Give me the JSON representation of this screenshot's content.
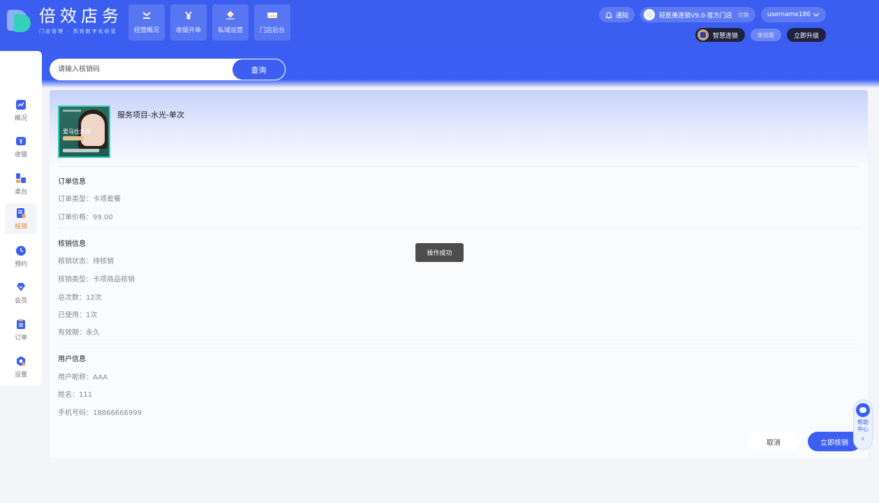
{
  "app": {
    "title": "倍效店务",
    "subtitle": "门店管理 · 高效数字化经营"
  },
  "top_nav": [
    {
      "label": "经营概况",
      "icon": "trend-icon"
    },
    {
      "label": "收银开单",
      "icon": "yen-icon"
    },
    {
      "label": "私域运营",
      "icon": "diamond-icon"
    },
    {
      "label": "门店后台",
      "icon": "store-icon"
    }
  ],
  "header": {
    "notify_label": "通知",
    "store_name": "轻医美连锁V9.0-官方门店",
    "switch_label": "切换",
    "username": "username186",
    "plan_label": "智慧连锁",
    "trial_label": "体验版",
    "upgrade_label": "立即升级"
  },
  "sidebar": {
    "items": [
      {
        "label": "概况",
        "icon": "chart-icon",
        "active": false
      },
      {
        "label": "收银",
        "icon": "cashier-icon",
        "active": false
      },
      {
        "label": "桌台",
        "icon": "tables-icon",
        "active": false
      },
      {
        "label": "核销",
        "icon": "verify-icon",
        "active": true
      },
      {
        "label": "预约",
        "icon": "clock-icon",
        "active": false
      },
      {
        "label": "会员",
        "icon": "member-icon",
        "active": false
      },
      {
        "label": "订单",
        "icon": "order-icon",
        "active": false
      },
      {
        "label": "设置",
        "icon": "settings-icon",
        "active": false
      }
    ]
  },
  "search": {
    "placeholder": "请输入核销码",
    "value": "",
    "button_label": "查询"
  },
  "detail": {
    "thumb_text": "爱马仕水光",
    "service_title": "服务项目-水光-单次",
    "order_section": {
      "title": "订单信息",
      "rows": [
        "订单类型：卡项套餐",
        "订单价格：99.00"
      ]
    },
    "verify_section": {
      "title": "核销信息",
      "rows": [
        "核销状态：待核销",
        "核销类型：卡项商品核销",
        "总次数：12次",
        "已使用：1次",
        "有效期：永久"
      ]
    },
    "user_section": {
      "title": "用户信息",
      "rows": [
        "用户昵称：AAA",
        "姓名：111",
        "手机号码：18866666999"
      ]
    },
    "cancel_label": "取消",
    "confirm_label": "立即核销"
  },
  "toast": {
    "text": "操作成功"
  },
  "help": {
    "label": "帮助中心"
  },
  "colors": {
    "primary": "#3c5ff2",
    "active_sidebar": "#d48a3c",
    "dark_chip": "#1f2340"
  }
}
